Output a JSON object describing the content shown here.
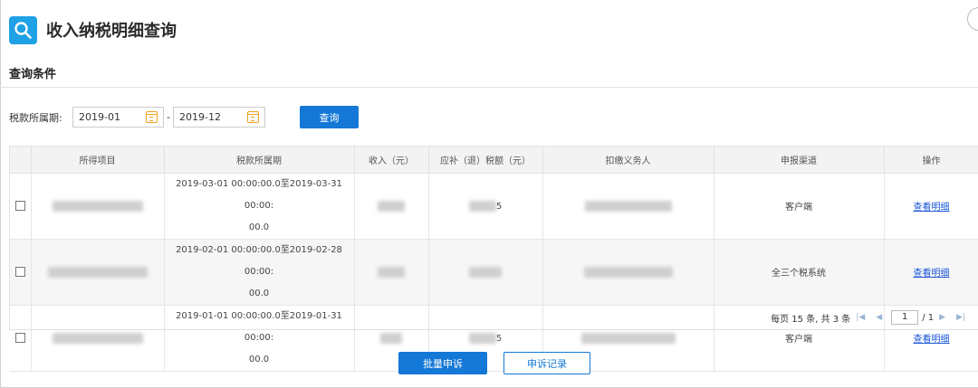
{
  "page": {
    "title": "收入纳税明细查询",
    "section_title": "查询条件"
  },
  "filter": {
    "label": "税款所属期:",
    "start_date": "2019-01",
    "separator": "-",
    "end_date": "2019-12",
    "query_button": "查询"
  },
  "table": {
    "headers": [
      "所得项目",
      "税款所属期",
      "收入（元）",
      "应补（退）税额（元）",
      "扣缴义务人",
      "申报渠道",
      "操作"
    ],
    "rows": [
      {
        "period_line1": "2019-03-01 00:00:00.0至2019-03-31 00:00:",
        "period_line2": "00.0",
        "tax_suffix": "5",
        "channel": "客户端",
        "action": "查看明细"
      },
      {
        "period_line1": "2019-02-01 00:00:00.0至2019-02-28 00:00:",
        "period_line2": "00.0",
        "tax_suffix": "",
        "channel": "全三个税系统",
        "action": "查看明细"
      },
      {
        "period_line1": "2019-01-01 00:00:00.0至2019-01-31 00:00:",
        "period_line2": "00.0",
        "tax_suffix": "5",
        "channel": "客户端",
        "action": "查看明细"
      }
    ]
  },
  "pager": {
    "summary": "每页 15 条, 共 3 条",
    "current_page": "1",
    "total_pages": "/ 1"
  },
  "footer": {
    "batch_appeal_button": "批量申诉",
    "appeal_record_button": "申诉记录"
  },
  "colors": {
    "primary": "#1478d6",
    "logo": "#1fa1e6",
    "calendar_icon": "#f0a020"
  }
}
